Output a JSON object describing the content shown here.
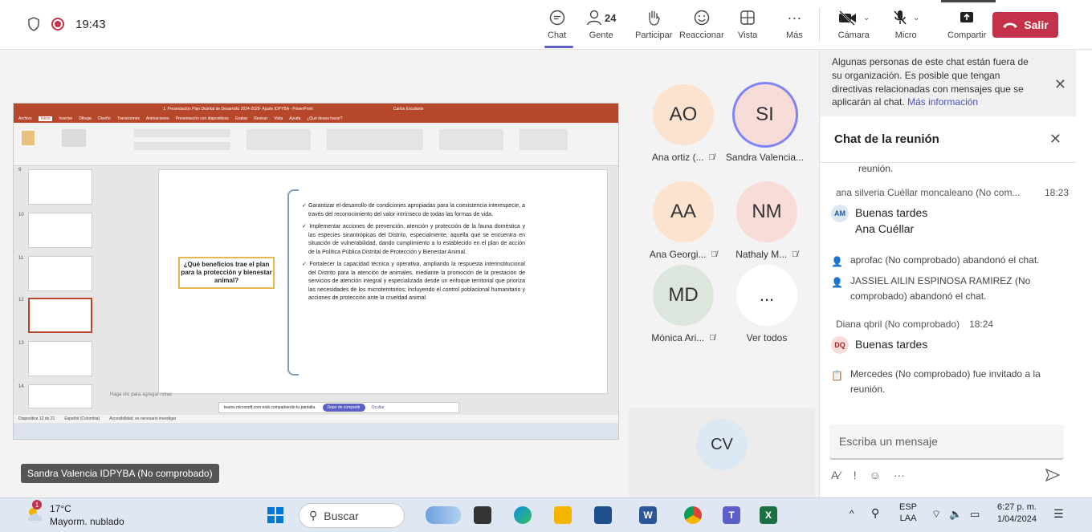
{
  "status": {
    "time": "19:43"
  },
  "toolbar": {
    "chat": "Chat",
    "people": "Gente",
    "people_count": "24",
    "raise": "Participar",
    "react": "Reaccionar",
    "view": "Vista",
    "more": "Más",
    "camera": "Cámara",
    "mic": "Micro",
    "share": "Compartir",
    "leave": "Salir",
    "accent": "#5b5fc7",
    "leave_color": "#c4314b"
  },
  "participants": [
    {
      "initials": "AO",
      "name": "Ana ortiz (...",
      "muted": true
    },
    {
      "initials": "SI",
      "name": "Sandra Valencia...",
      "muted": false
    },
    {
      "initials": "AA",
      "name": "Ana Georgi...",
      "muted": true
    },
    {
      "initials": "NM",
      "name": "Nathaly M...",
      "muted": true
    },
    {
      "initials": "MD",
      "name": "Mónica Ari...",
      "muted": true
    },
    {
      "initials": "...",
      "name": "Ver todos",
      "muted": false
    }
  ],
  "cv_tile": "CV",
  "presenter_tag": "Sandra Valencia IDPYBA (No comprobado)",
  "slide": {
    "title_bar": "1. Presentación Plan Distrital de Desarrollo 2024-2028- Ajuste IDPYBA - PowerPoint",
    "user": "Carlos Escalante",
    "tabs": [
      "Archivo",
      "Inicio",
      "Insertar",
      "Dibujar",
      "Diseño",
      "Transiciones",
      "Animaciones",
      "Presentación con diapositivas",
      "Grabar",
      "Revisar",
      "Vista",
      "Ayuda",
      "¿Qué desea hacer?"
    ],
    "thumb_numbers": [
      "9",
      "10",
      "11",
      "12",
      "13",
      "14"
    ],
    "question": "¿Qué beneficios trae el plan para la protección y bienestar animal?",
    "bullets": [
      "✓ Garantizar el desarrollo de condiciones apropiadas para la coexistencia interespecie, a través del reconocimiento del valor intrínseco de todas las formas de vida.",
      "✓ Implementar acciones de prevención, atención y protección de la fauna doméstica y las especies sinantrópicas del Distrito, especialmente, aquella que se encuentra en situación de vulnerabilidad, dando cumplimiento a lo establecido en el plan de acción de la Política Pública Distrital de Protección y Bienestar Animal.",
      "✓ Fortalecer la capacidad técnica y operativa, ampliando la respuesta interinstitucional del Distrito para la atención de animales, mediante la promoción de la prestación de servicios de atención integral y especializada desde un enfoque territorial que prioriza las necesidades de los microterritorios; incluyendo el control poblacional humanitario y acciones de protección ante la crueldad animal."
    ],
    "notes_placeholder": "Haga clic para agregar notas",
    "status_left": "Diapositiva 12 de 21",
    "status_lang": "Español (Colombia)",
    "status_access": "Accesibilidad: es necesario investigar",
    "share_notice": "teams.microsoft.com está compartiendo tu pantalla.",
    "stop_share": "Dejar de compartir",
    "hide": "Ocultar"
  },
  "chat": {
    "notice": "Algunas personas de este chat están fuera de su organización. Es posible que tengan directivas relacionadas con mensajes que se aplicarán al chat.",
    "notice_link": "Más información",
    "title": "Chat de la reunión",
    "top_fragment": "reunión.",
    "messages": [
      {
        "author": "ana silveria Cuéllar moncaleano (No com...",
        "time": "18:23",
        "initials": "AM",
        "lines": [
          "Buenas tardes",
          "Ana Cuéllar"
        ]
      },
      {
        "system": "aprofac (No comprobado) abandonó el chat."
      },
      {
        "system": "JASSIEL AILIN ESPINOSA RAMIREZ (No comprobado) abandonó el chat."
      },
      {
        "author": "Diana qbril (No comprobado)",
        "time": "18:24",
        "initials": "DQ",
        "lines": [
          "Buenas tardes"
        ]
      },
      {
        "system": "Mercedes (No comprobado) fue invitado a la reunión."
      }
    ],
    "input_placeholder": "Escriba un mensaje"
  },
  "taskbar": {
    "temp": "17°C",
    "weather": "Mayorm. nublado",
    "badge": "1",
    "search": "Buscar",
    "lang": "ESP",
    "lang2": "LAA",
    "time": "6:27 p. m.",
    "date": "1/04/2024"
  }
}
